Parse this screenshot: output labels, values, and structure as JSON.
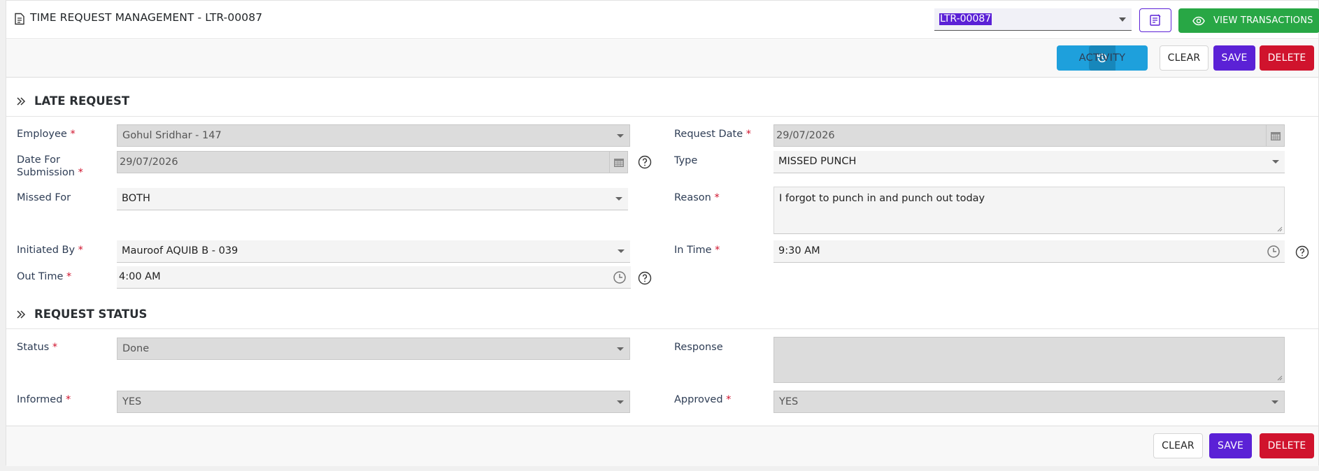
{
  "header": {
    "title": "TIME REQUEST MANAGEMENT - LTR-00087",
    "selected_transaction": "LTR-00087",
    "view_transactions_label": "VIEW TRANSACTIONS"
  },
  "toolbar": {
    "activity_label": "ACTIVITY",
    "clear_label": "CLEAR",
    "save_label": "SAVE",
    "delete_label": "DELETE"
  },
  "late_request": {
    "title": "LATE REQUEST",
    "employee": {
      "label": "Employee",
      "value": "Gohul Sridhar - 147"
    },
    "request_date": {
      "label": "Request Date",
      "value": "29/07/2026"
    },
    "date_for_submission": {
      "label_line1": "Date For",
      "label_line2": "Submission",
      "value": "29/07/2026"
    },
    "type": {
      "label": "Type",
      "value": "MISSED PUNCH"
    },
    "missed_for": {
      "label": "Missed For",
      "value": "BOTH"
    },
    "reason": {
      "label": "Reason",
      "value": "I forgot to punch in and punch out today"
    },
    "initiated_by": {
      "label": "Initiated By",
      "value": "Mauroof AQUIB B - 039"
    },
    "in_time": {
      "label": "In Time",
      "value": "9:30 AM"
    },
    "out_time": {
      "label": "Out Time",
      "value": "4:00 AM"
    }
  },
  "request_status": {
    "title": "REQUEST STATUS",
    "status": {
      "label": "Status",
      "value": "Done"
    },
    "response": {
      "label": "Response",
      "value": ""
    },
    "informed": {
      "label": "Informed",
      "value": "YES"
    },
    "approved": {
      "label": "Approved",
      "value": "YES"
    }
  },
  "footer": {
    "clear_label": "CLEAR",
    "save_label": "SAVE",
    "delete_label": "DELETE"
  },
  "colors": {
    "primary": "#5b21d6",
    "success": "#28a745",
    "danger": "#d0132d",
    "info": "#1ea0dc"
  },
  "required_mark": "*"
}
